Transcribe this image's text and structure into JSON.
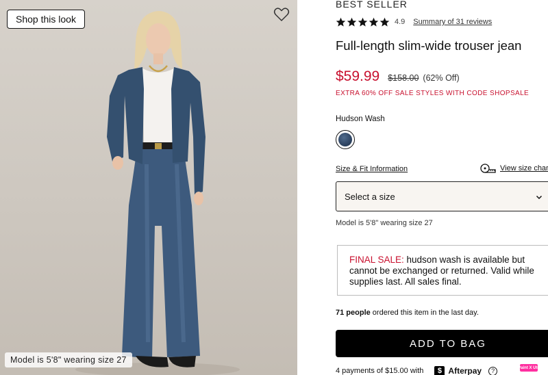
{
  "photo": {
    "shop_look_label": "Shop this look",
    "model_caption": "Model is 5'8\" wearing size 27",
    "favorite_icon": "heart-icon"
  },
  "product": {
    "eyebrow": "BEST SELLER",
    "rating_value": "4.9",
    "rating_stars": 5,
    "reviews_link": "Summary of 31 reviews",
    "title": "Full-length slim-wide trouser jean",
    "sale_price": "$59.99",
    "original_price": "$158.00",
    "percent_off": "(62% Off)",
    "promo": "EXTRA 60% OFF SALE STYLES WITH CODE SHOPSALE"
  },
  "color": {
    "label": "Hudson Wash",
    "swatch_icon": "color-swatch-icon"
  },
  "size": {
    "fit_link": "Size & Fit Information",
    "chart_link": "View size chart",
    "chart_icon": "measuring-tape-icon",
    "select_placeholder": "Select a size",
    "model_note": "Model is 5'8\" wearing size 27"
  },
  "final_sale": {
    "label": "FINAL SALE:",
    "text": " hudson wash is available but cannot be exchanged or returned. Valid while supplies last. All sales final."
  },
  "social_proof": {
    "count": "71 people",
    "text": " ordered this item in the last day."
  },
  "cta": {
    "add_to_bag": "ADD TO BAG"
  },
  "afterpay": {
    "text": "4 payments of $15.00 with",
    "brand": "Afterpay",
    "icon_glyph": "$",
    "help_glyph": "?"
  },
  "extension_badge": "Paint X Ute",
  "colors": {
    "sale_red": "#c8102e",
    "button_black": "#000000",
    "select_bg": "#f8f5f1",
    "swatch_denim": "#2a3f5c"
  }
}
